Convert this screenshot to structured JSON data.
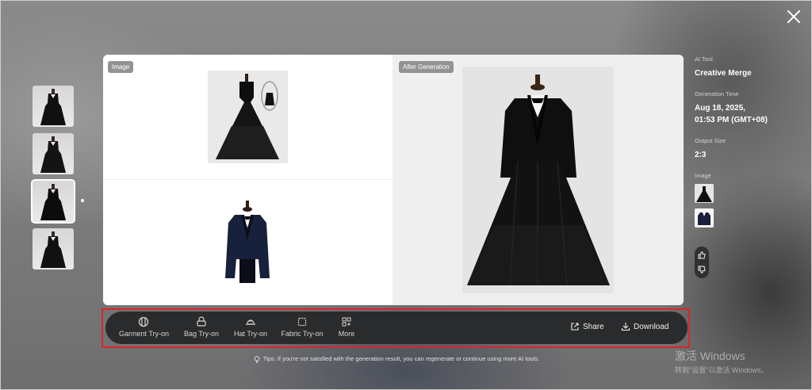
{
  "left_panel": {
    "image_tag": "Image"
  },
  "right_panel": {
    "after_tag": "After Generation"
  },
  "toolbar": {
    "tools": [
      {
        "label": "Garment Try-on",
        "icon": "garment-icon"
      },
      {
        "label": "Bag Try-on",
        "icon": "bag-icon"
      },
      {
        "label": "Hat Try-on",
        "icon": "hat-icon"
      },
      {
        "label": "Fabric Try-on",
        "icon": "fabric-icon"
      },
      {
        "label": "More",
        "icon": "more-grid-icon"
      }
    ],
    "share_label": "Share",
    "download_label": "Download"
  },
  "tips": "Tips: If you're not satisfied with the generation result, you can regenerate or continue using more AI tools.",
  "info": {
    "ai_tool_key": "AI Tool",
    "ai_tool_value": "Creative Merge",
    "gen_time_key": "Generation Time",
    "gen_time_line1": "Aug 18, 2025,",
    "gen_time_line2": "01:53 PM (GMT+08)",
    "output_size_key": "Output Size",
    "output_size_value": "2:3",
    "image_key": "Image"
  },
  "watermark": {
    "line1": "激活 Windows",
    "line2": "转到\"设置\"以激活 Windows。"
  },
  "colors": {
    "toolbar_bg": "#2a2b2c",
    "highlight_outline": "#d9262c",
    "card_bg": "#ffffff"
  }
}
